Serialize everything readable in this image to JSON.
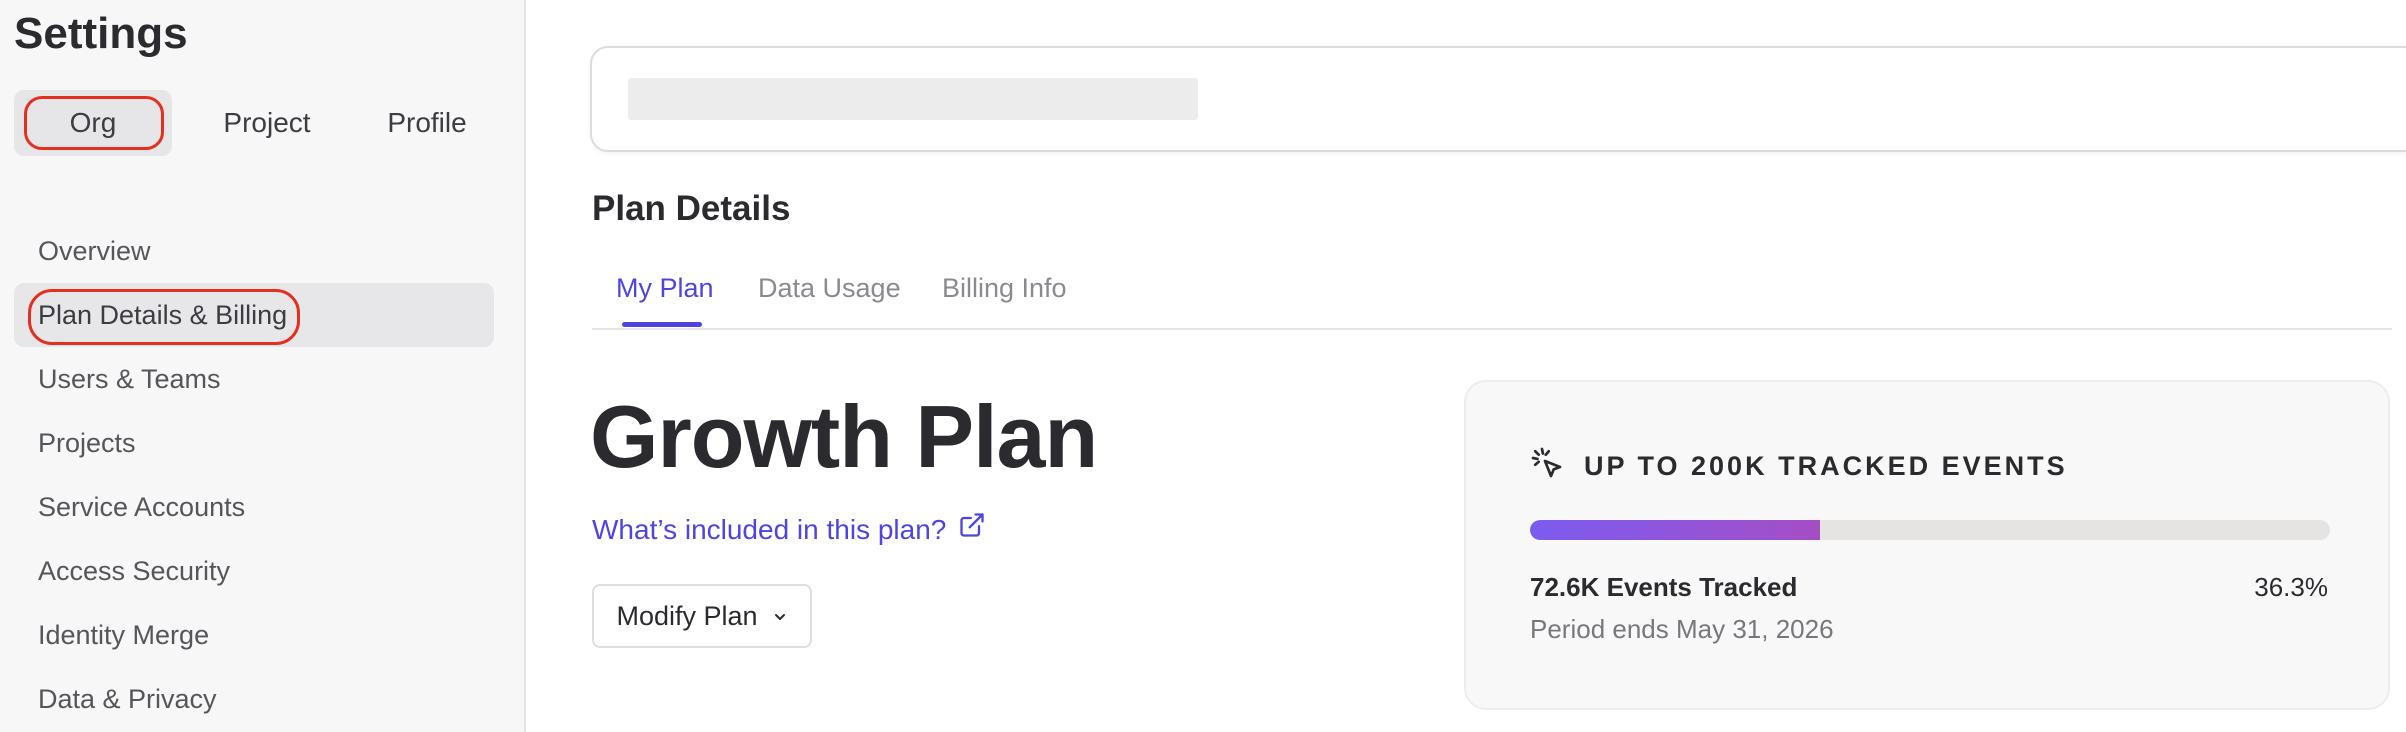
{
  "sidebar": {
    "title": "Settings",
    "scope_tabs": [
      {
        "label": "Org",
        "active": true
      },
      {
        "label": "Project",
        "active": false
      },
      {
        "label": "Profile",
        "active": false
      }
    ],
    "nav_items": [
      {
        "label": "Overview"
      },
      {
        "label": "Plan Details & Billing",
        "active": true
      },
      {
        "label": "Users & Teams"
      },
      {
        "label": "Projects"
      },
      {
        "label": "Service Accounts"
      },
      {
        "label": "Access Security"
      },
      {
        "label": "Identity Merge"
      },
      {
        "label": "Data & Privacy"
      }
    ]
  },
  "main": {
    "page_title": "Plan Details",
    "tabs": [
      {
        "label": "My Plan",
        "active": true
      },
      {
        "label": "Data Usage",
        "active": false
      },
      {
        "label": "Billing Info",
        "active": false
      }
    ],
    "plan_name": "Growth Plan",
    "plan_link": "What’s included in this plan?",
    "modify_button": "Modify Plan"
  },
  "usage": {
    "title": "UP TO 200K TRACKED EVENTS",
    "events_tracked": "72.6K Events Tracked",
    "percent": "36.3%",
    "progress_fraction": 0.363,
    "period_ends": "Period ends May 31, 2026"
  },
  "colors": {
    "accent": "#4f44e0",
    "highlight": "#e4301e",
    "progress_start": "#7b5cf0",
    "progress_end": "#a54ec4"
  },
  "icons": {
    "plan_link": "external-link-icon",
    "modify_button": "chevron-down-icon",
    "usage": "cursor-click-icon"
  }
}
